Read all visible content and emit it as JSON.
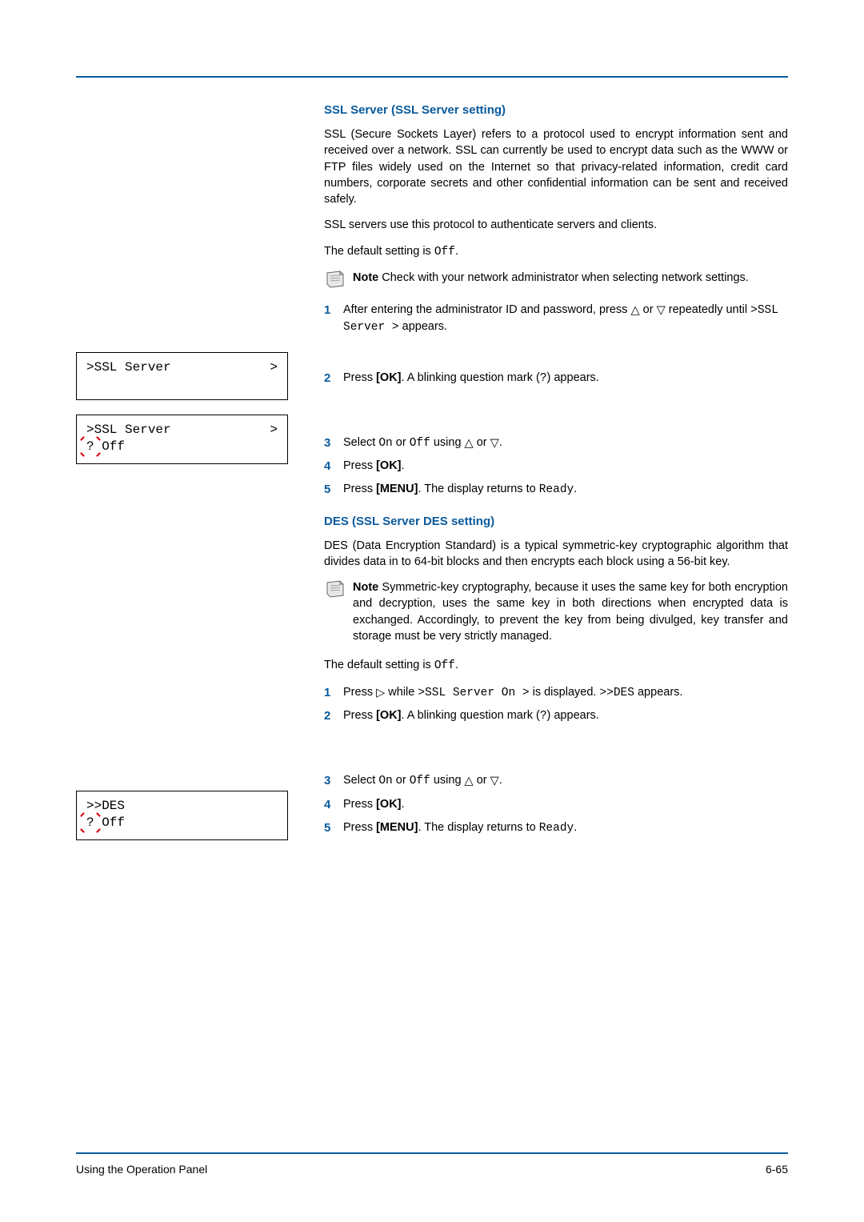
{
  "section1": {
    "heading": "SSL Server (SSL Server setting)",
    "para1": "SSL (Secure Sockets Layer) refers to a protocol used to encrypt information sent and received over a network. SSL can currently be used to encrypt data such as the WWW or FTP files widely used on the Internet so that privacy-related information, credit card numbers, corporate secrets and other confidential information can be sent and received safely.",
    "para2": "SSL servers use this protocol to authenticate servers and clients.",
    "para3_pre": "The default setting is ",
    "para3_code": "Off",
    "para3_post": ".",
    "note_bold": "Note",
    "note_text": "  Check with your network administrator when selecting network settings.",
    "steps": [
      {
        "n": "1",
        "pre": "After entering the administrator ID and password, press ",
        "mid": " or ",
        "post1": " repeatedly until ",
        "code": ">SSL Server >",
        "post2": " appears."
      },
      {
        "n": "2",
        "pre": "Press ",
        "bold": "[OK]",
        "mid": ". A blinking question mark (",
        "code": "?",
        "post": ") appears."
      },
      {
        "n": "3",
        "pre": "Select ",
        "code1": "On",
        "mid1": " or ",
        "code2": "Off",
        "mid2": " using ",
        "mid3": " or ",
        "post": "."
      },
      {
        "n": "4",
        "pre": "Press ",
        "bold": "[OK]",
        "post": "."
      },
      {
        "n": "5",
        "pre": "Press ",
        "bold": "[MENU]",
        "mid": ". The display returns to ",
        "code": "Ready",
        "post": "."
      }
    ]
  },
  "section2": {
    "heading": "DES (SSL Server DES setting)",
    "para1": "DES (Data Encryption Standard) is a typical symmetric-key cryptographic algorithm that divides data in to 64-bit blocks and then encrypts each block using a 56-bit key.",
    "note_bold": "Note",
    "note_text": "  Symmetric-key cryptography, because it uses the same key for both encryption and decryption, uses the same key in both directions when encrypted data is exchanged. Accordingly, to prevent the key from being divulged, key transfer and storage must be very strictly managed.",
    "para3_pre": "The default setting is ",
    "para3_code": "Off",
    "para3_post": ".",
    "steps": [
      {
        "n": "1",
        "pre": "Press ",
        "mid1": " while ",
        "code1": ">SSL Server  On >",
        "mid2": " is displayed. ",
        "code2": ">>DES",
        "post": " appears."
      },
      {
        "n": "2",
        "pre": "Press ",
        "bold": "[OK]",
        "mid": ". A blinking question mark (",
        "code": "?",
        "post": ") appears."
      },
      {
        "n": "3",
        "pre": "Select ",
        "code1": "On",
        "mid1": " or ",
        "code2": "Off",
        "mid2": " using ",
        "mid3": " or ",
        "post": "."
      },
      {
        "n": "4",
        "pre": "Press ",
        "bold": "[OK]",
        "post": "."
      },
      {
        "n": "5",
        "pre": "Press ",
        "bold": "[MENU]",
        "mid": ". The display returns to ",
        "code": "Ready",
        "post": "."
      }
    ]
  },
  "lcd1": {
    "line1_left": ">SSL Server",
    "line1_right": ">"
  },
  "lcd2": {
    "line1_left": ">SSL Server",
    "line1_right": ">",
    "line2": "? Off"
  },
  "lcd3": {
    "line1": ">>DES",
    "line2": "? Off"
  },
  "footer": {
    "left": "Using the Operation Panel",
    "right": "6-65"
  },
  "glyphs": {
    "tri_up": "△",
    "tri_down": "▽",
    "tri_right": "▷"
  }
}
